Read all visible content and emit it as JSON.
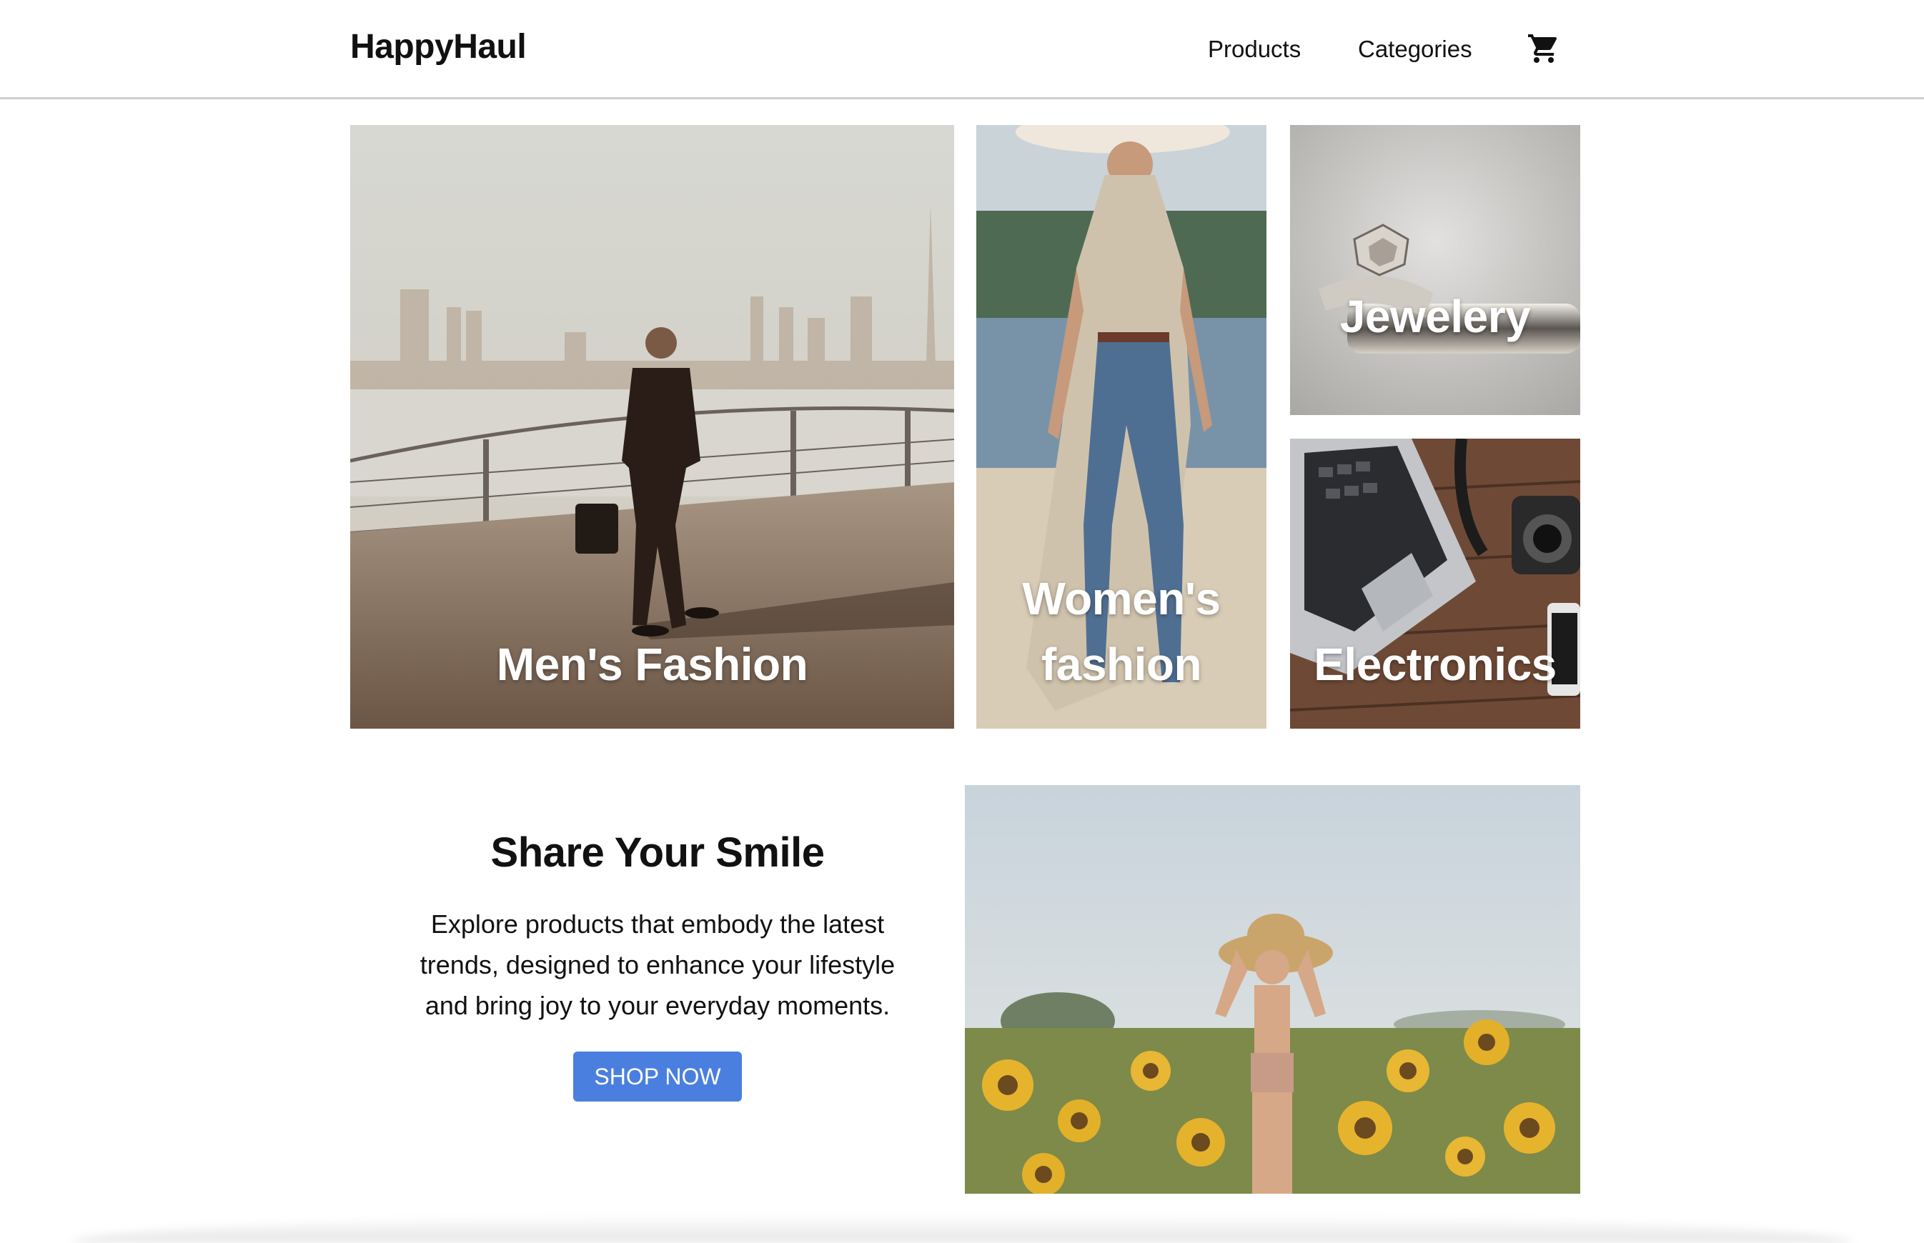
{
  "header": {
    "brand": "HappyHaul",
    "nav": {
      "products": "Products",
      "categories": "Categories"
    },
    "cart_icon": "shopping-cart-icon"
  },
  "categories": {
    "mens": "Men's Fashion",
    "womens_line1": "Women's",
    "womens_line2": "fashion",
    "jewelery": "Jewelery",
    "electronics": "Electronics"
  },
  "promo": {
    "title": "Share Your Smile",
    "text_line1": "Explore products that embody the latest",
    "text_line2": "trends, designed to enhance your lifestyle",
    "text_line3": "and bring joy to your everyday moments.",
    "button": "SHOP NOW"
  },
  "colors": {
    "accent": "#4a7fe0",
    "text": "#111111",
    "divider": "#cfcfcf"
  }
}
